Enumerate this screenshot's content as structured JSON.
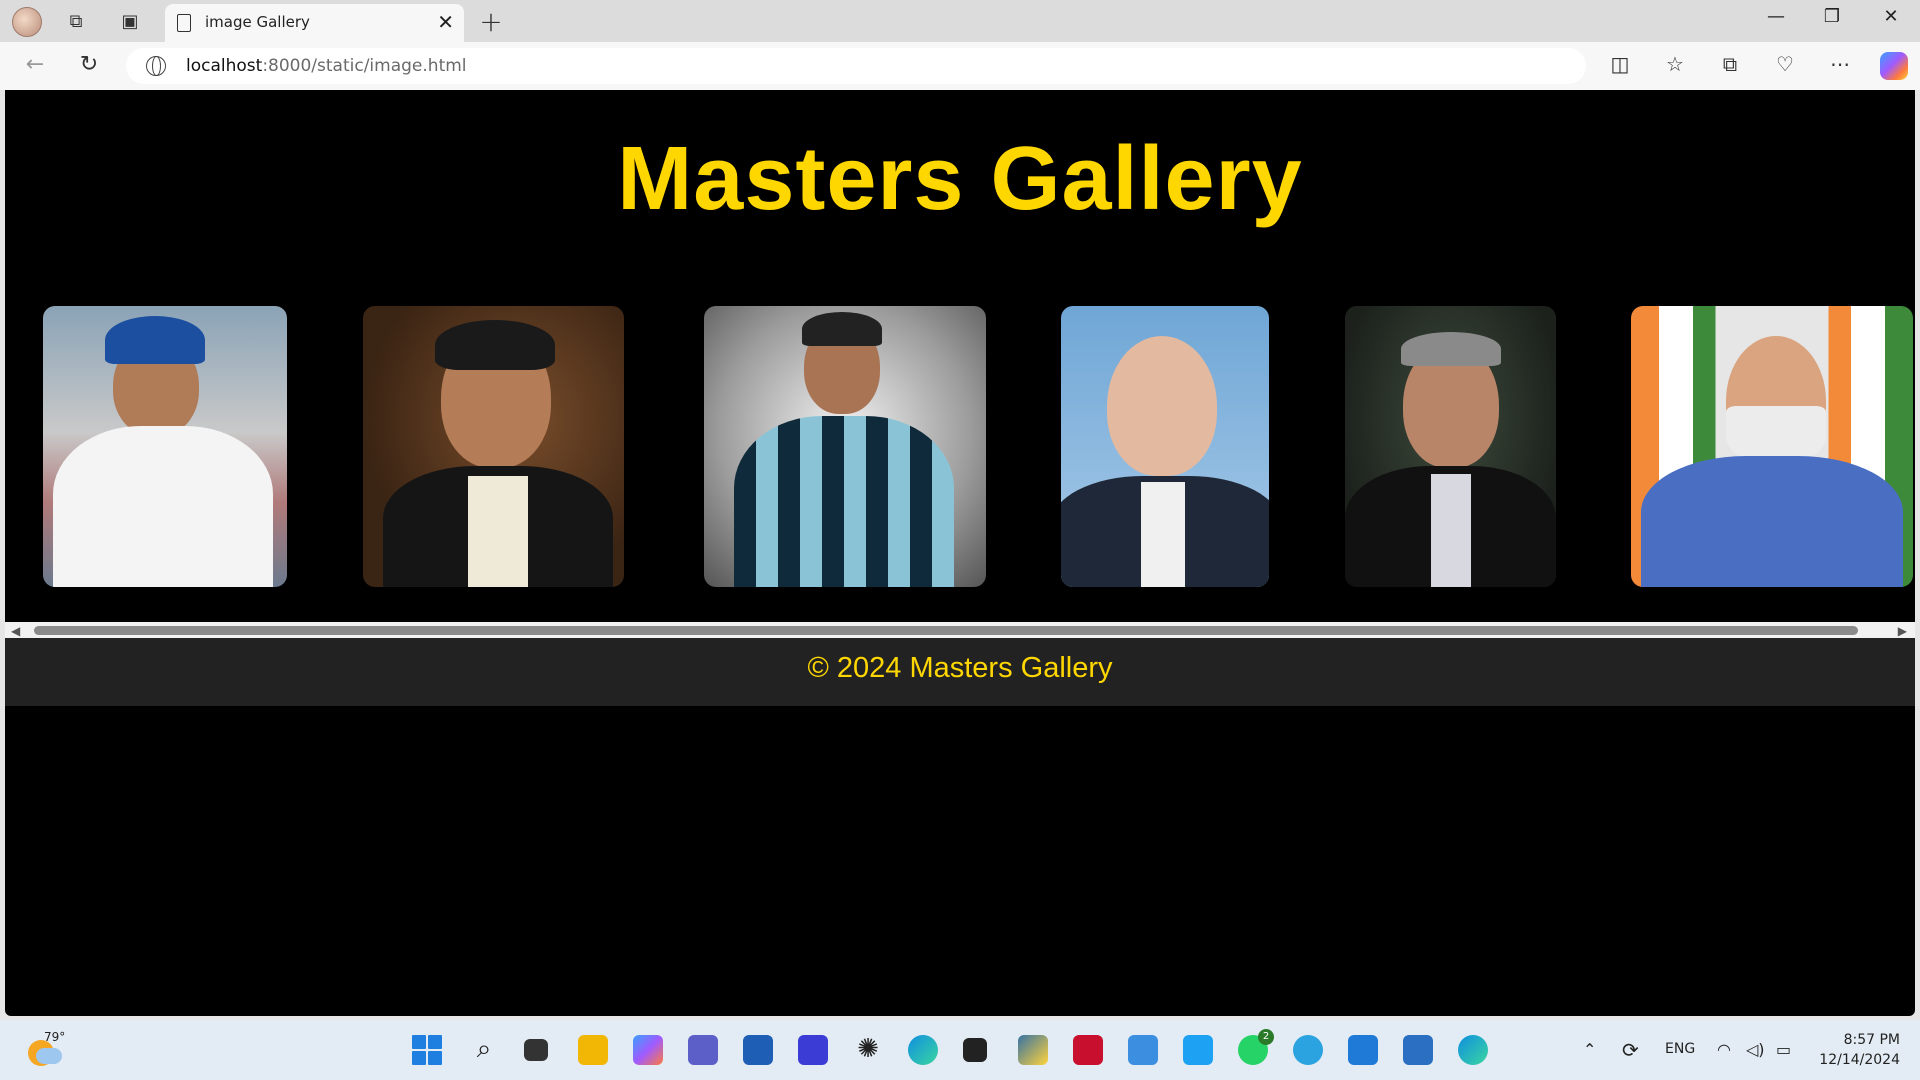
{
  "browser": {
    "tab_title": "image Gallery",
    "tab_close": "✕",
    "new_tab": "+",
    "url_host": "localhost",
    "url_rest": ":8000/static/image.html",
    "window_controls": {
      "minimize": "—",
      "restore": "❐",
      "close": "✕"
    }
  },
  "page": {
    "title": "Masters Gallery",
    "images": [
      {
        "name": "photo-cricketer"
      },
      {
        "name": "photo-businessman"
      },
      {
        "name": "photo-footballer"
      },
      {
        "name": "photo-leader-suit"
      },
      {
        "name": "photo-industrialist"
      },
      {
        "name": "photo-leader-vest"
      }
    ],
    "footer_text": "© 2024 Masters Gallery"
  },
  "taskbar": {
    "weather_temp": "79°",
    "whatsapp_badge": "2",
    "language": "ENG",
    "time": "8:57 PM",
    "date": "12/14/2024"
  },
  "colors": {
    "accent_gold": "#ffd700",
    "page_bg": "#000000",
    "footer_bg": "#222222"
  }
}
